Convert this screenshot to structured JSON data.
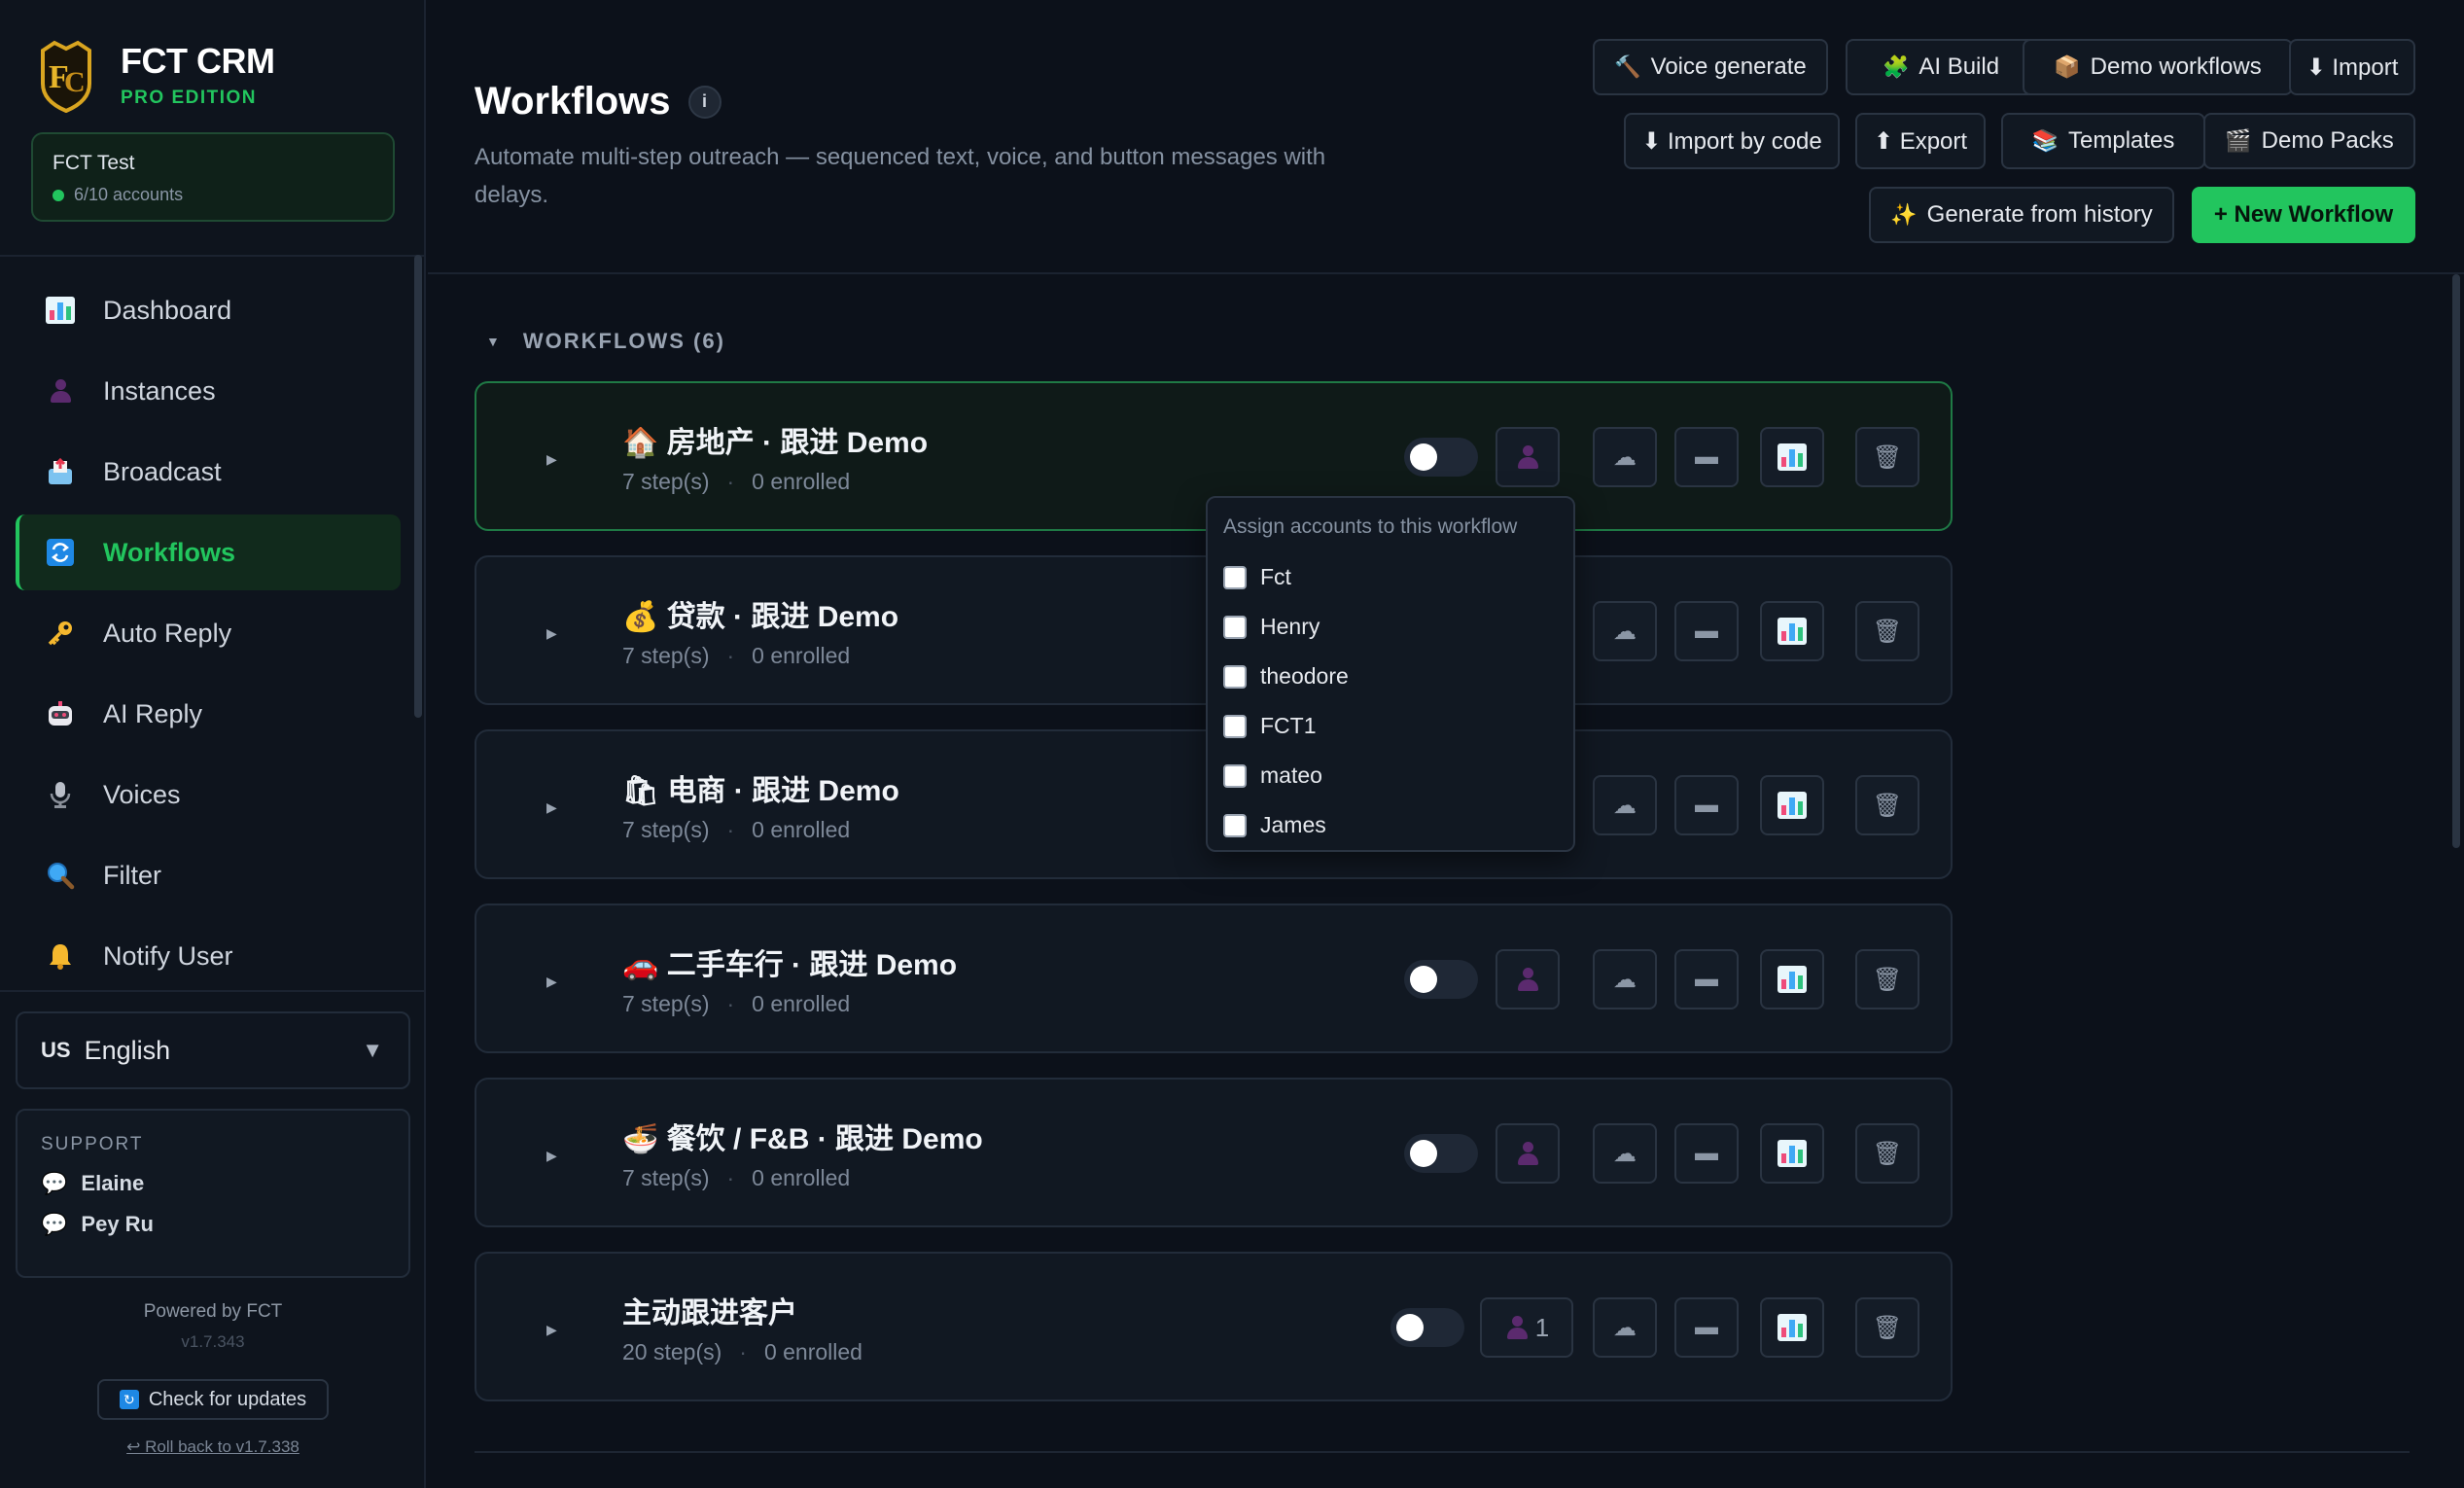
{
  "brand": {
    "title": "FCT CRM",
    "subtitle": "PRO EDITION"
  },
  "account": {
    "name": "FCT Test",
    "count": "6/10 accounts"
  },
  "nav": [
    {
      "label": "Dashboard",
      "icon": "chart-icon"
    },
    {
      "label": "Instances",
      "icon": "person-icon"
    },
    {
      "label": "Broadcast",
      "icon": "outbox-icon"
    },
    {
      "label": "Workflows",
      "icon": "repeat-icon",
      "active": true
    },
    {
      "label": "Auto Reply",
      "icon": "key-icon"
    },
    {
      "label": "AI Reply",
      "icon": "robot-icon"
    },
    {
      "label": "Voices",
      "icon": "microphone-icon"
    },
    {
      "label": "Filter",
      "icon": "magnifier-icon"
    },
    {
      "label": "Notify User",
      "icon": "bell-icon"
    }
  ],
  "language": {
    "flag": "US",
    "label": "English"
  },
  "support": {
    "title": "SUPPORT",
    "contacts": [
      "Elaine",
      "Pey Ru"
    ]
  },
  "footer": {
    "powered": "Powered by FCT",
    "version": "v1.7.343",
    "check_updates": "Check for updates",
    "rollback": "↩ Roll back to v1.7.338"
  },
  "header": {
    "title": "Workflows",
    "info": "i",
    "subtitle": "Automate multi-step outreach — sequenced text, voice, and button messages with delays.",
    "buttons": {
      "voice_generate": "Voice generate",
      "ai_build": "AI Build",
      "demo_workflows": "Demo workflows",
      "import": "⬇ Import",
      "import_by_code": "⬇ Import by code",
      "export": "⬆ Export",
      "templates": "Templates",
      "demo_packs": "Demo Packs",
      "generate_from_history": "Generate from history",
      "new_workflow": "+ New Workflow"
    }
  },
  "section": {
    "title": "WORKFLOWS (6)"
  },
  "workflows": [
    {
      "emoji": "🏠",
      "title": "房地产 · 跟进 Demo",
      "steps": "7 step(s)",
      "enrolled": "0 enrolled",
      "assigned": ""
    },
    {
      "emoji": "💰",
      "title": "贷款 · 跟进 Demo",
      "steps": "7 step(s)",
      "enrolled": "0 enrolled",
      "assigned": ""
    },
    {
      "emoji": "🛍",
      "title": "电商 · 跟进 Demo",
      "steps": "7 step(s)",
      "enrolled": "0 enrolled",
      "assigned": ""
    },
    {
      "emoji": "🚗",
      "title": "二手车行 · 跟进 Demo",
      "steps": "7 step(s)",
      "enrolled": "0 enrolled",
      "assigned": ""
    },
    {
      "emoji": "🍜",
      "title": "餐饮 / F&B · 跟进 Demo",
      "steps": "7 step(s)",
      "enrolled": "0 enrolled",
      "assigned": ""
    },
    {
      "emoji": "",
      "title": "主动跟进客户",
      "steps": "20 step(s)",
      "enrolled": "0 enrolled",
      "assigned": "1"
    }
  ],
  "popover": {
    "title": "Assign accounts to this workflow",
    "accounts": [
      "Fct",
      "Henry",
      "theodore",
      "FCT1",
      "mateo",
      "James"
    ]
  },
  "colors": {
    "accent": "#22c55e",
    "background": "#0c111a",
    "panel": "#111822"
  }
}
